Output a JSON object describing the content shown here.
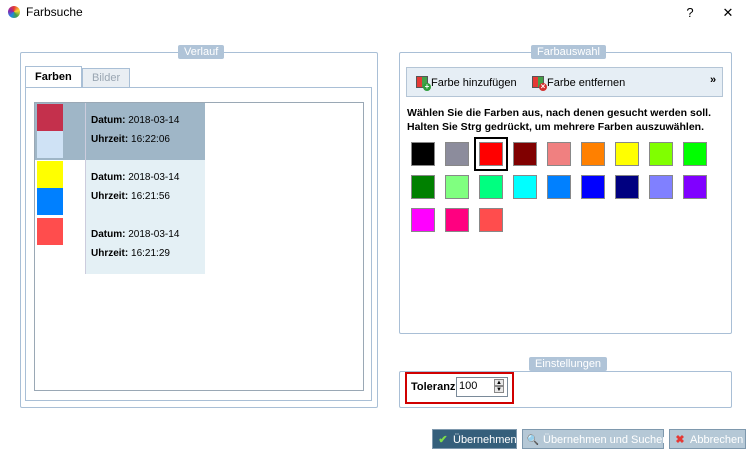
{
  "window": {
    "title": "Farbsuche",
    "help_label": "?",
    "close_label": "✕"
  },
  "history": {
    "group_title": "Verlauf",
    "tabs": [
      {
        "label": "Farben",
        "active": true
      },
      {
        "label": "Bilder",
        "active": false
      }
    ],
    "entries": [
      {
        "date_label": "Datum:",
        "date": "2018-03-14",
        "time_label": "Uhrzeit:",
        "time": "16:22:06",
        "colors": [
          "#c4304c",
          "#cfe2f5"
        ],
        "selected": true
      },
      {
        "date_label": "Datum:",
        "date": "2018-03-14",
        "time_label": "Uhrzeit:",
        "time": "16:21:56",
        "colors": [
          "#ffff00",
          "#0080ff"
        ],
        "selected": false
      },
      {
        "date_label": "Datum:",
        "date": "2018-03-14",
        "time_label": "Uhrzeit:",
        "time": "16:21:29",
        "colors": [
          "#ff4d4d"
        ],
        "selected": false
      }
    ]
  },
  "color_selection": {
    "group_title": "Farbauswahl",
    "toolbar": {
      "add_label": "Farbe hinzufügen",
      "remove_label": "Farbe entfernen",
      "more_label": "»"
    },
    "instruction_line1": "Wählen Sie die Farben aus, nach denen gesucht werden soll.",
    "instruction_line2": "Halten Sie Strg gedrückt, um mehrere Farben auszuwählen.",
    "palette": [
      {
        "color": "#000000",
        "selected": false
      },
      {
        "color": "#8c8c9c",
        "selected": false
      },
      {
        "color": "#ff0000",
        "selected": true
      },
      {
        "color": "#800000",
        "selected": false
      },
      {
        "color": "#f08080",
        "selected": false
      },
      {
        "color": "#ff8000",
        "selected": false
      },
      {
        "color": "#ffff00",
        "selected": false
      },
      {
        "color": "#80ff00",
        "selected": false
      },
      {
        "color": "#00ff00",
        "selected": false
      },
      {
        "color": "#008000",
        "selected": false
      },
      {
        "color": "#80ff80",
        "selected": false
      },
      {
        "color": "#00ff80",
        "selected": false
      },
      {
        "color": "#00ffff",
        "selected": false
      },
      {
        "color": "#0080ff",
        "selected": false
      },
      {
        "color": "#0000ff",
        "selected": false
      },
      {
        "color": "#000080",
        "selected": false
      },
      {
        "color": "#8080ff",
        "selected": false
      },
      {
        "color": "#8000ff",
        "selected": false
      },
      {
        "color": "#ff00ff",
        "selected": false
      },
      {
        "color": "#ff0080",
        "selected": false
      },
      {
        "color": "#ff4d4d",
        "selected": false
      }
    ]
  },
  "settings": {
    "group_title": "Einstellungen",
    "tolerance_label": "Toleranz:",
    "tolerance_value": "100",
    "spin_up": "▲",
    "spin_down": "▼"
  },
  "buttons": {
    "apply_label": "Übernehmen",
    "apply_icon": "✔",
    "apply_search_label": "Übernehmen und Suchen",
    "apply_search_icon": "🔍",
    "cancel_label": "Abbrechen",
    "cancel_icon": "✖"
  },
  "colors": {
    "accent_red": "#d00000",
    "group_border": "#a9bfd6",
    "primary_button": "#355f7b"
  }
}
